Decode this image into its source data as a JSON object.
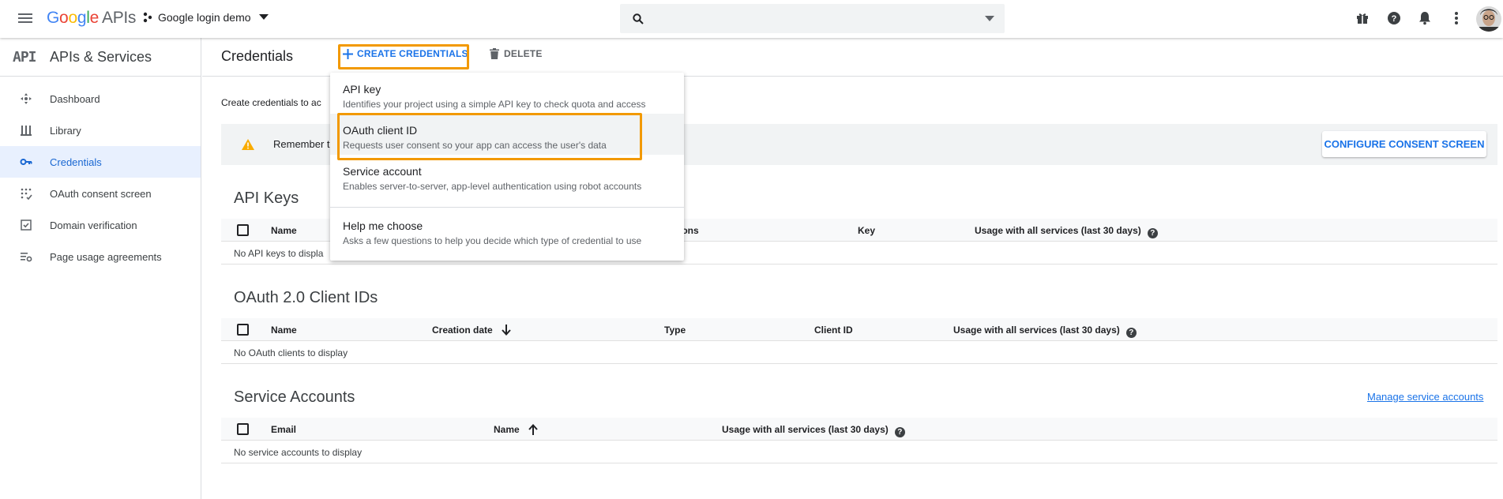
{
  "topbar": {
    "logo_google": [
      "G",
      "o",
      "o",
      "g",
      "l",
      "e"
    ],
    "logo_apis": "APIs",
    "project_name": "Google login demo",
    "search_placeholder": ""
  },
  "sidebar": {
    "header_badge": "API",
    "header_title": "APIs & Services",
    "items": [
      {
        "label": "Dashboard",
        "icon": "dashboard-icon"
      },
      {
        "label": "Library",
        "icon": "library-icon"
      },
      {
        "label": "Credentials",
        "icon": "key-icon",
        "active": true
      },
      {
        "label": "OAuth consent screen",
        "icon": "consent-icon"
      },
      {
        "label": "Domain verification",
        "icon": "checkbox-icon"
      },
      {
        "label": "Page usage agreements",
        "icon": "settings-list-icon"
      }
    ]
  },
  "header": {
    "title": "Credentials",
    "create_label": "CREATE CREDENTIALS",
    "delete_label": "DELETE"
  },
  "intro_text": "Create credentials to ac",
  "warning": {
    "text": "Remember t",
    "configure_label": "CONFIGURE CONSENT SCREEN"
  },
  "dropdown": {
    "items": [
      {
        "title": "API key",
        "desc": "Identifies your project using a simple API key to check quota and access"
      },
      {
        "title": "OAuth client ID",
        "desc": "Requests user consent so your app can access the user's data"
      },
      {
        "title": "Service account",
        "desc": "Enables server-to-server, app-level authentication using robot accounts"
      },
      {
        "title": "Help me choose",
        "desc": "Asks a few questions to help you decide which type of credential to use"
      }
    ]
  },
  "api_keys": {
    "title": "API Keys",
    "col_name": "Name",
    "col_restrictions": "ions",
    "col_key": "Key",
    "col_usage": "Usage with all services (last 30 days)",
    "empty": "No API keys to displa"
  },
  "oauth": {
    "title": "OAuth 2.0 Client IDs",
    "col_name": "Name",
    "col_created": "Creation date",
    "col_type": "Type",
    "col_client": "Client ID",
    "col_usage": "Usage with all services (last 30 days)",
    "empty": "No OAuth clients to display"
  },
  "service_accounts": {
    "title": "Service Accounts",
    "manage_link": "Manage service accounts",
    "col_email": "Email",
    "col_name": "Name",
    "col_usage": "Usage with all services (last 30 days)",
    "empty": "No service accounts to display"
  },
  "colors": {
    "accent": "#1a73e8",
    "highlight": "#f29900",
    "warning": "#f9ab00",
    "active_bg": "#e8f0fe"
  }
}
